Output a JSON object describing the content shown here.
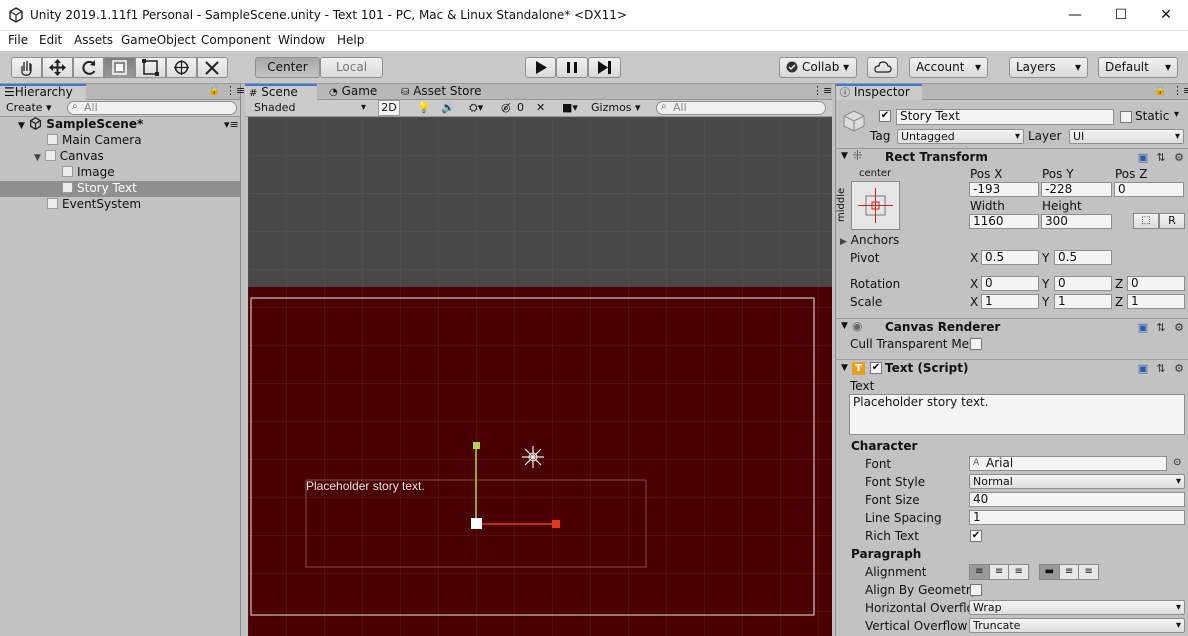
{
  "window": {
    "title": "Unity 2019.1.11f1 Personal - SampleScene.unity - Text 101 - PC, Mac & Linux Standalone* <DX11>",
    "minimize": "—",
    "maximize": "☐",
    "close": "✕"
  },
  "menu": [
    "File",
    "Edit",
    "Assets",
    "GameObject",
    "Component",
    "Window",
    "Help"
  ],
  "toolbar": {
    "pivot_center": "Center",
    "pivot_local": "Local",
    "collab": "Collab",
    "account": "Account",
    "layers": "Layers",
    "layout": "Default"
  },
  "hierarchy": {
    "tab": "Hierarchy",
    "create": "Create",
    "search_placeholder": "All",
    "scene": "SampleScene*",
    "items": [
      "Main Camera",
      "Canvas",
      "Image",
      "Story Text",
      "EventSystem"
    ]
  },
  "scene_view": {
    "tabs": [
      "Scene",
      "Game",
      "Asset Store"
    ],
    "shading": "Shaded",
    "mode_2d": "2D",
    "hidden_count": "0",
    "gizmos": "Gizmos",
    "search_placeholder": "All",
    "text_preview": "Placeholder story text."
  },
  "inspector": {
    "tab": "Inspector",
    "object_name": "Story Text",
    "static_label": "Static",
    "tag_label": "Tag",
    "tag_value": "Untagged",
    "layer_label": "Layer",
    "layer_value": "UI",
    "rect_transform": {
      "title": "Rect Transform",
      "anchor_h": "center",
      "anchor_v": "middle",
      "pos_x_label": "Pos X",
      "pos_x": "-193",
      "pos_y_label": "Pos Y",
      "pos_y": "-228",
      "pos_z_label": "Pos Z",
      "pos_z": "0",
      "width_label": "Width",
      "width": "1160",
      "height_label": "Height",
      "height": "300",
      "anchors_label": "Anchors",
      "pivot_label": "Pivot",
      "pivot_x": "0.5",
      "pivot_y": "0.5",
      "rotation_label": "Rotation",
      "rot_x": "0",
      "rot_y": "0",
      "rot_z": "0",
      "scale_label": "Scale",
      "scale_x": "1",
      "scale_y": "1",
      "scale_z": "1",
      "raw_btn": "R"
    },
    "canvas_renderer": {
      "title": "Canvas Renderer",
      "cull_label": "Cull Transparent Mes"
    },
    "text_script": {
      "title": "Text (Script)",
      "text_label": "Text",
      "text_value": "Placeholder story text.",
      "character_header": "Character",
      "font_label": "Font",
      "font_value": "Arial",
      "font_style_label": "Font Style",
      "font_style_value": "Normal",
      "font_size_label": "Font Size",
      "font_size_value": "40",
      "line_spacing_label": "Line Spacing",
      "line_spacing_value": "1",
      "rich_text_label": "Rich Text",
      "paragraph_header": "Paragraph",
      "alignment_label": "Alignment",
      "align_geom_label": "Align By Geometry",
      "h_overflow_label": "Horizontal Overflo",
      "h_overflow_value": "Wrap",
      "v_overflow_label": "Vertical Overflow",
      "v_overflow_value": "Truncate"
    }
  },
  "colors": {
    "scene_bg": "#474747",
    "canvas_fill": "#4a0000",
    "selection_blue": "#3b77d8"
  }
}
